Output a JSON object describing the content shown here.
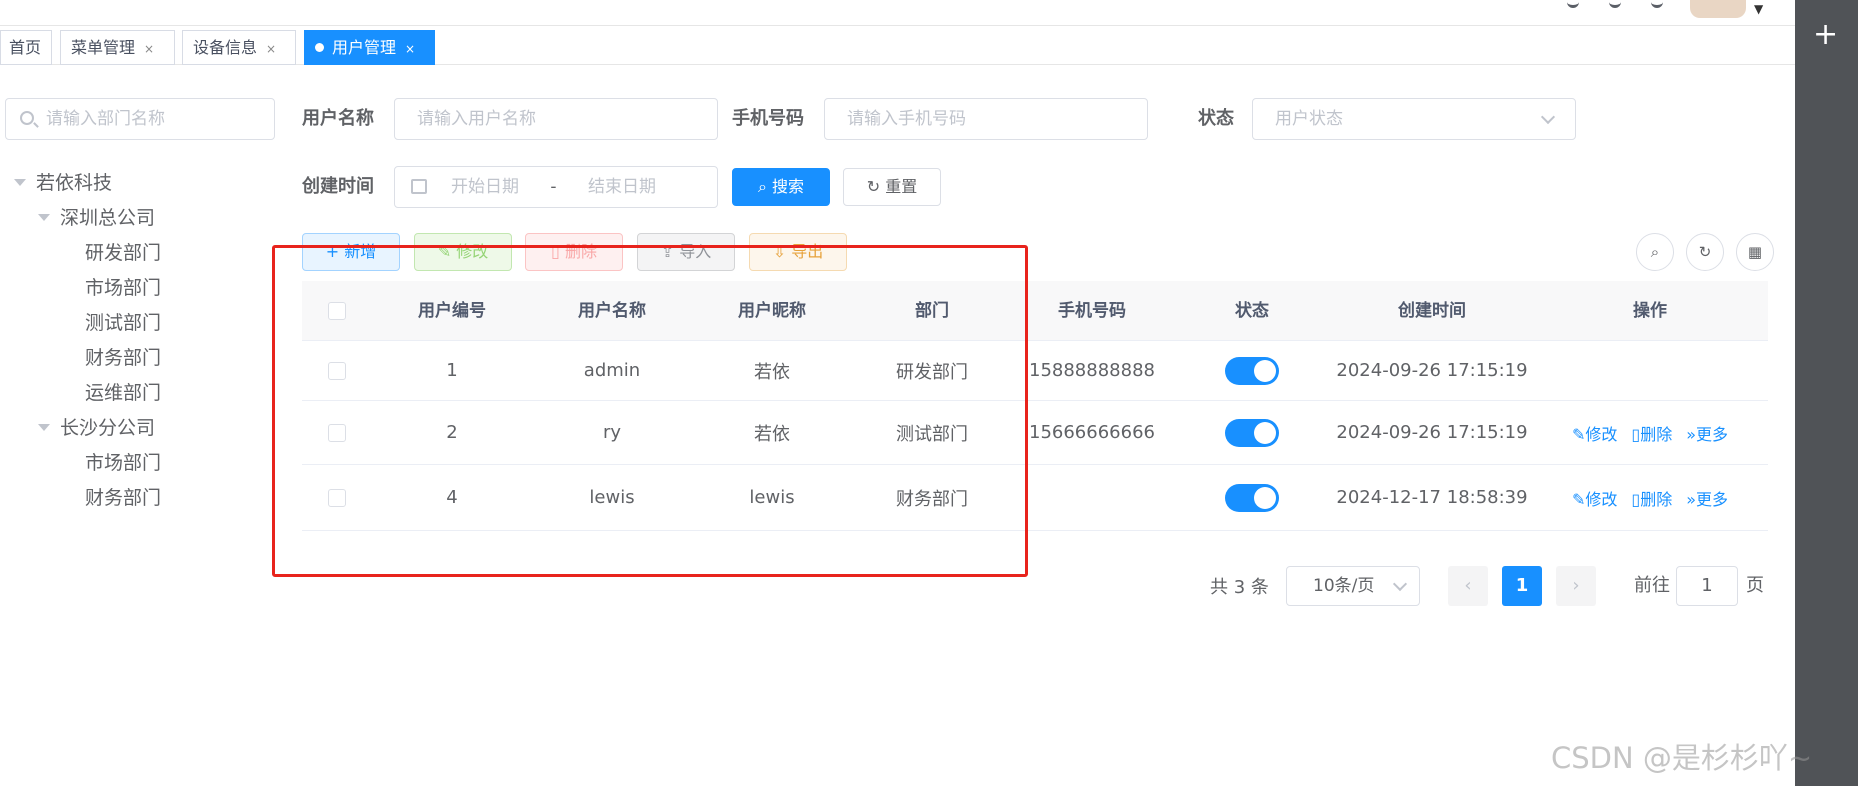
{
  "tabs": [
    {
      "label": "首页",
      "closable": false
    },
    {
      "label": "菜单管理",
      "closable": true
    },
    {
      "label": "设备信息",
      "closable": true
    },
    {
      "label": "用户管理",
      "closable": true,
      "active": true
    }
  ],
  "tab_close_glyph": "×",
  "dept_search": {
    "placeholder": "请输入部门名称",
    "icon": "search-icon"
  },
  "tree": {
    "root": "若依科技",
    "branches": [
      {
        "label": "深圳总公司",
        "children": [
          "研发部门",
          "市场部门",
          "测试部门",
          "财务部门",
          "运维部门"
        ]
      },
      {
        "label": "长沙分公司",
        "children": [
          "市场部门",
          "财务部门"
        ]
      }
    ]
  },
  "filters": {
    "username_label": "用户名称",
    "username_placeholder": "请输入用户名称",
    "phone_label": "手机号码",
    "phone_placeholder": "请输入手机号码",
    "status_label": "状态",
    "status_placeholder": "用户状态",
    "created_label": "创建时间",
    "start_placeholder": "开始日期",
    "range_separator": "-",
    "end_placeholder": "结束日期",
    "search_label": "搜索",
    "reset_label": "重置"
  },
  "toolbar": {
    "add_label": "新增",
    "edit_label": "修改",
    "delete_label": "删除",
    "import_label": "导入",
    "export_label": "导出",
    "right_icons": [
      "search-icon",
      "refresh-icon",
      "grid-icon"
    ]
  },
  "table": {
    "headers": [
      "用户编号",
      "用户名称",
      "用户昵称",
      "部门",
      "手机号码",
      "状态",
      "创建时间",
      "操作"
    ],
    "rows": [
      {
        "id": "1",
        "username": "admin",
        "nickname": "若依",
        "dept": "研发部门",
        "phone": "15888888888",
        "status_on": true,
        "created": "2024-09-26 17:15:19",
        "ops": []
      },
      {
        "id": "2",
        "username": "ry",
        "nickname": "若依",
        "dept": "测试部门",
        "phone": "15666666666",
        "status_on": true,
        "created": "2024-09-26 17:15:19",
        "ops": [
          "修改",
          "删除",
          "更多"
        ]
      },
      {
        "id": "4",
        "username": "lewis",
        "nickname": "lewis",
        "dept": "财务部门",
        "phone": "",
        "status_on": true,
        "created": "2024-12-17 18:58:39",
        "ops": [
          "修改",
          "删除",
          "更多"
        ]
      }
    ]
  },
  "pagination": {
    "total_text": "共 3 条",
    "page_size": "10条/页",
    "prev": "‹",
    "current": "1",
    "next": "›",
    "goto_label": "前往",
    "goto_value": "1",
    "page_suffix": "页"
  },
  "rail": {
    "plus": "+"
  },
  "watermark": "CSDN @是杉杉吖~",
  "colors": {
    "primary": "#1890ff",
    "highlight_box": "#e8231c",
    "rail": "#505357"
  }
}
